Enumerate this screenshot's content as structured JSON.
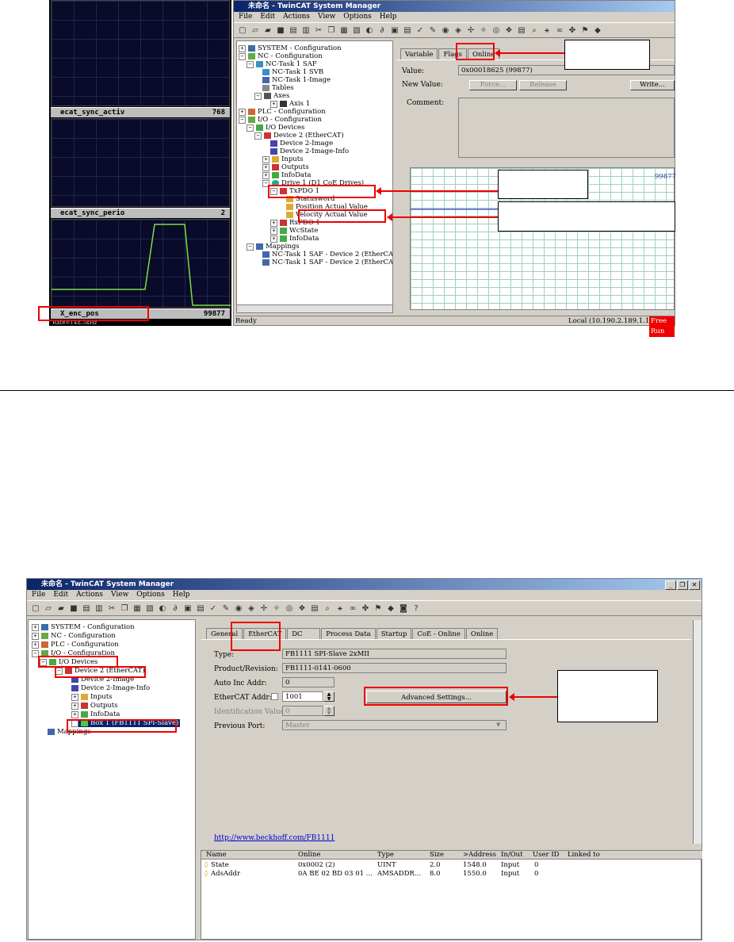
{
  "scope": {
    "signals": [
      {
        "name": "ecat_sync_activ",
        "value": "768"
      },
      {
        "name": "ecat_sync_perio",
        "value": "2"
      },
      {
        "name": "X_enc_pos",
        "value": "99877"
      }
    ],
    "rate_text": "Rate=148.5kHz"
  },
  "win1": {
    "title": "未命名 - TwinCAT System Manager",
    "menu": [
      "File",
      "Edit",
      "Actions",
      "View",
      "Options",
      "Help"
    ],
    "tree": [
      "SYSTEM - Configuration",
      "NC - Configuration",
      "NC-Task 1 SAF",
      "NC-Task 1 SVB",
      "NC-Task 1-Image",
      "Tables",
      "Axes",
      "Axis 1",
      "PLC - Configuration",
      "I/O - Configuration",
      "I/O Devices",
      "Device 2 (EtherCAT)",
      "Device 2-Image",
      "Device 2-Image-Info",
      "Inputs",
      "Outputs",
      "InfoData",
      "Drive 1 (D1 CoE Drives)",
      "TxPDO 1",
      "Statusword",
      "Position Actual Value",
      "Velocity Actual Value",
      "RxPDO 1",
      "WcState",
      "InfoData",
      "Mappings",
      "NC-Task 1 SAF - Device 2 (EtherCAT)",
      "NC-Task 1 SAF - Device 2 (EtherCAT)"
    ],
    "tabs": [
      "Variable",
      "Flags",
      "Online"
    ],
    "value_label": "Value:",
    "value": "0x00018625 (99877)",
    "new_value_label": "New Value:",
    "force_label": "Force...",
    "release_label": "Release",
    "write_label": "Write...",
    "comment_label": "Comment:",
    "graph_value": "99877",
    "status_ready": "Ready",
    "status_local": "Local (10.190.2.189.1.1)",
    "status_mode": "Free Run"
  },
  "win2": {
    "title": "未命名 - TwinCAT System Manager",
    "menu": [
      "File",
      "Edit",
      "Actions",
      "View",
      "Options",
      "Help"
    ],
    "tree": [
      "SYSTEM - Configuration",
      "NC - Configuration",
      "PLC - Configuration",
      "I/O - Configuration",
      "I/O Devices",
      "Device 2 (EtherCAT)",
      "Device 2-Image",
      "Device 2-Image-Info",
      "Inputs",
      "Outputs",
      "InfoData",
      "Box 1 (FB1111 SPI-Slave)",
      "Mappings"
    ],
    "tabs": [
      "General",
      "EtherCAT",
      "DC",
      "Process Data",
      "Startup",
      "CoE - Online",
      "Online"
    ],
    "type_label": "Type:",
    "type_value": "FB1111 SPI-Slave 2xMII",
    "product_label": "Product/Revision:",
    "product_value": "FB1111-0141-0600",
    "autoinc_label": "Auto Inc Addr:",
    "autoinc_value": "0",
    "ecat_addr_label": "EtherCAT Addr:",
    "ecat_addr_value": "1001",
    "ident_label": "Identification Value:",
    "ident_value": "0",
    "prev_port_label": "Previous Port:",
    "prev_port_value": "Master",
    "advanced_label": "Advanced Settings...",
    "link": "http://www.beckhoff.com/FB1111",
    "list_headers": [
      "Name",
      "Online",
      "Type",
      "Size",
      ">Address",
      "In/Out",
      "User ID",
      "Linked to"
    ],
    "list_rows": [
      [
        "State",
        "0x0002 (2)",
        "UINT",
        "2.0",
        "1548.0",
        "Input",
        "0",
        ""
      ],
      [
        "AdsAddr",
        "0A BE 02 BD 03 01 ...",
        "AMSADDR...",
        "8.0",
        "1550.0",
        "Input",
        "0",
        ""
      ]
    ]
  }
}
